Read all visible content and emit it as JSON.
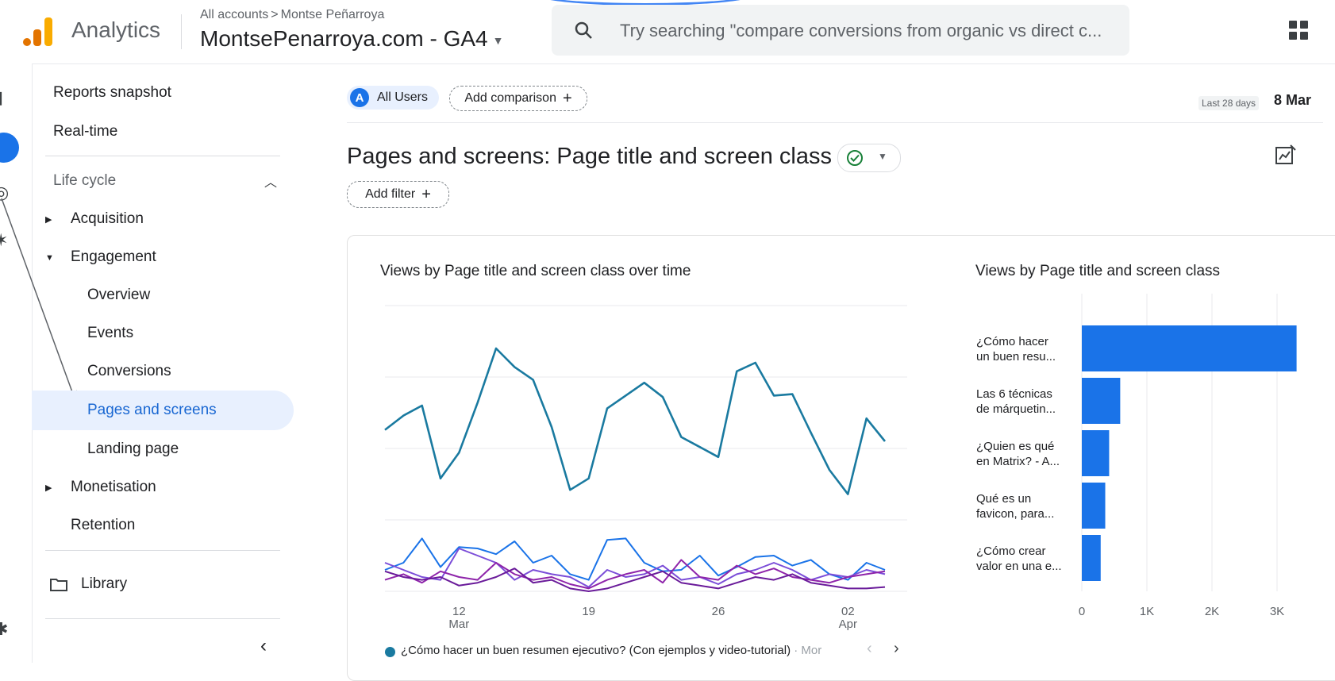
{
  "header": {
    "app_name": "Analytics",
    "breadcrumb_root": "All accounts",
    "breadcrumb_child": "Montse Peñarroya",
    "property": "MontsePenarroya.com - GA4",
    "search_placeholder": "Try searching \"compare conversions from organic vs direct c..."
  },
  "sidebar": {
    "snapshot": "Reports snapshot",
    "realtime": "Real-time",
    "lifecycle": "Life cycle",
    "acquisition": "Acquisition",
    "engagement": "Engagement",
    "overview": "Overview",
    "events": "Events",
    "conversions": "Conversions",
    "pages": "Pages and screens",
    "landing": "Landing page",
    "monetisation": "Monetisation",
    "retention": "Retention",
    "library": "Library"
  },
  "toolbar": {
    "segment_badge": "A",
    "segment": "All Users",
    "add_comparison": "Add comparison",
    "date_range_label": "Last 28 days",
    "date_range_start": "8 Mar"
  },
  "report": {
    "title": "Pages and screens: Page title and screen class",
    "add_filter": "Add filter"
  },
  "colors": {
    "brand_blue": "#1a73e8",
    "teal": "#1a7aa0",
    "purple_dark": "#6a1b9a",
    "purple": "#8e24aa",
    "violet": "#7b4dd8"
  },
  "chart_data": [
    {
      "type": "line",
      "title": "Views by Page title and screen class over time",
      "x_ticks": [
        "12 Mar",
        "19",
        "26",
        "02 Apr"
      ],
      "x_tick_top": [
        "12",
        "19",
        "26",
        "02"
      ],
      "x_tick_bottom": [
        "Mar",
        "",
        "",
        "Apr"
      ],
      "y_ticks": [
        0,
        50,
        100,
        150,
        200
      ],
      "ylim": [
        0,
        200
      ],
      "grid": true,
      "legend": "bottom",
      "legend_first": "¿Cómo hacer un buen resumen ejecutivo? (Con ejemplos y video-tutorial)",
      "legend_more": "Mor",
      "series": [
        {
          "name": "¿Cómo hacer un buen resumen ejecutivo? (Con ejemplos y video-tutorial)",
          "color": "#1a7aa0",
          "values": [
            113,
            123,
            130,
            79,
            97,
            132,
            170,
            157,
            148,
            115,
            71,
            79,
            128,
            137,
            146,
            136,
            108,
            101,
            94,
            154,
            160,
            137,
            138,
            111,
            85,
            68,
            121,
            105
          ]
        },
        {
          "values": [
            15,
            20,
            37,
            17,
            31,
            30,
            26,
            35,
            20,
            25,
            12,
            8,
            36,
            37,
            20,
            14,
            15,
            25,
            11,
            17,
            24,
            25,
            18,
            22,
            12,
            8,
            20,
            15
          ],
          "color": "#1a73e8"
        },
        {
          "values": [
            20,
            15,
            10,
            8,
            30,
            25,
            20,
            8,
            15,
            12,
            10,
            3,
            15,
            10,
            12,
            18,
            8,
            10,
            5,
            12,
            15,
            20,
            15,
            8,
            12,
            10,
            15,
            12
          ],
          "color": "#7b4dd8"
        },
        {
          "values": [
            8,
            12,
            6,
            14,
            10,
            8,
            20,
            12,
            8,
            10,
            5,
            2,
            8,
            12,
            15,
            6,
            22,
            10,
            8,
            18,
            12,
            16,
            10,
            8,
            6,
            10,
            12,
            14
          ],
          "color": "#8e24aa"
        },
        {
          "values": [
            14,
            10,
            8,
            10,
            4,
            6,
            10,
            16,
            6,
            8,
            2,
            0,
            2,
            6,
            10,
            14,
            6,
            4,
            2,
            6,
            10,
            8,
            12,
            6,
            4,
            2,
            2,
            3
          ],
          "color": "#6a1b9a"
        }
      ]
    },
    {
      "type": "bar",
      "orientation": "horizontal",
      "title": "Views by Page title and screen class",
      "categories": [
        [
          "¿Cómo hacer",
          "un buen resu..."
        ],
        [
          "Las 6 técnicas",
          "de márquetin..."
        ],
        [
          "¿Quien es qué",
          "en Matrix? - A..."
        ],
        [
          "Qué es un",
          "favicon, para..."
        ],
        [
          "¿Cómo crear",
          "valor en una e..."
        ]
      ],
      "values": [
        3300,
        590,
        420,
        360,
        290
      ],
      "x_ticks": [
        "0",
        "1K",
        "2K",
        "3K"
      ],
      "xlim": [
        0,
        3500
      ],
      "color": "#1a73e8"
    }
  ]
}
